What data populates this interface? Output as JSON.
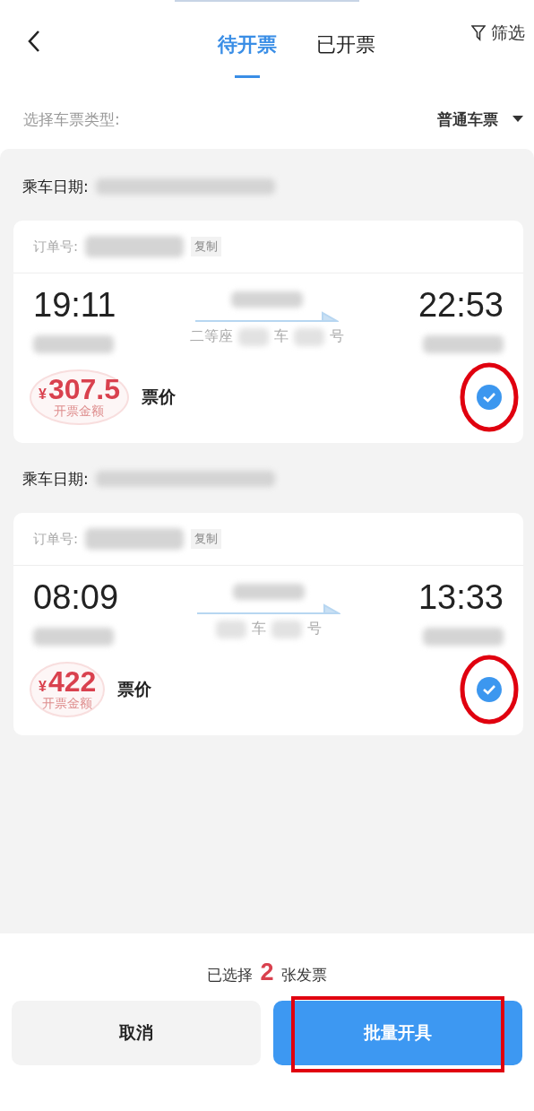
{
  "header": {
    "tabs": [
      {
        "label": "待开票",
        "selected": true
      },
      {
        "label": "已开票",
        "selected": false
      }
    ],
    "filter": "筛选"
  },
  "ticket_type": {
    "label": "选择车票类型:",
    "value": "普通车票"
  },
  "groups": [
    {
      "date_label": "乘车日期:",
      "order_label": "订单号:",
      "copy": "复制",
      "depart": "19:11",
      "arrive": "22:53",
      "seat_parts": [
        {
          "kind": "text",
          "text": "二等座"
        },
        {
          "kind": "blur"
        },
        {
          "kind": "text",
          "text": "车"
        },
        {
          "kind": "blur"
        },
        {
          "kind": "text",
          "text": "号"
        }
      ],
      "currency": "¥",
      "price": "307.5",
      "stamp": "开票金额",
      "price_label": "票价",
      "checked": true,
      "highlighted": true
    },
    {
      "date_label": "乘车日期:",
      "order_label": "订单号:",
      "copy": "复制",
      "depart": "08:09",
      "arrive": "13:33",
      "seat_parts": [
        {
          "kind": "blur"
        },
        {
          "kind": "text",
          "text": "车"
        },
        {
          "kind": "blur"
        },
        {
          "kind": "text",
          "text": "号"
        }
      ],
      "currency": "¥",
      "price": "422",
      "stamp": "开票金额",
      "price_label": "票价",
      "checked": true,
      "highlighted": true
    }
  ],
  "summary": {
    "prefix": "已选择",
    "count": "2",
    "suffix": "张发票"
  },
  "buttons": [
    {
      "kind": "secondary",
      "label": "取消",
      "highlighted": false
    },
    {
      "kind": "primary",
      "label": "批量开具",
      "highlighted": true
    }
  ]
}
